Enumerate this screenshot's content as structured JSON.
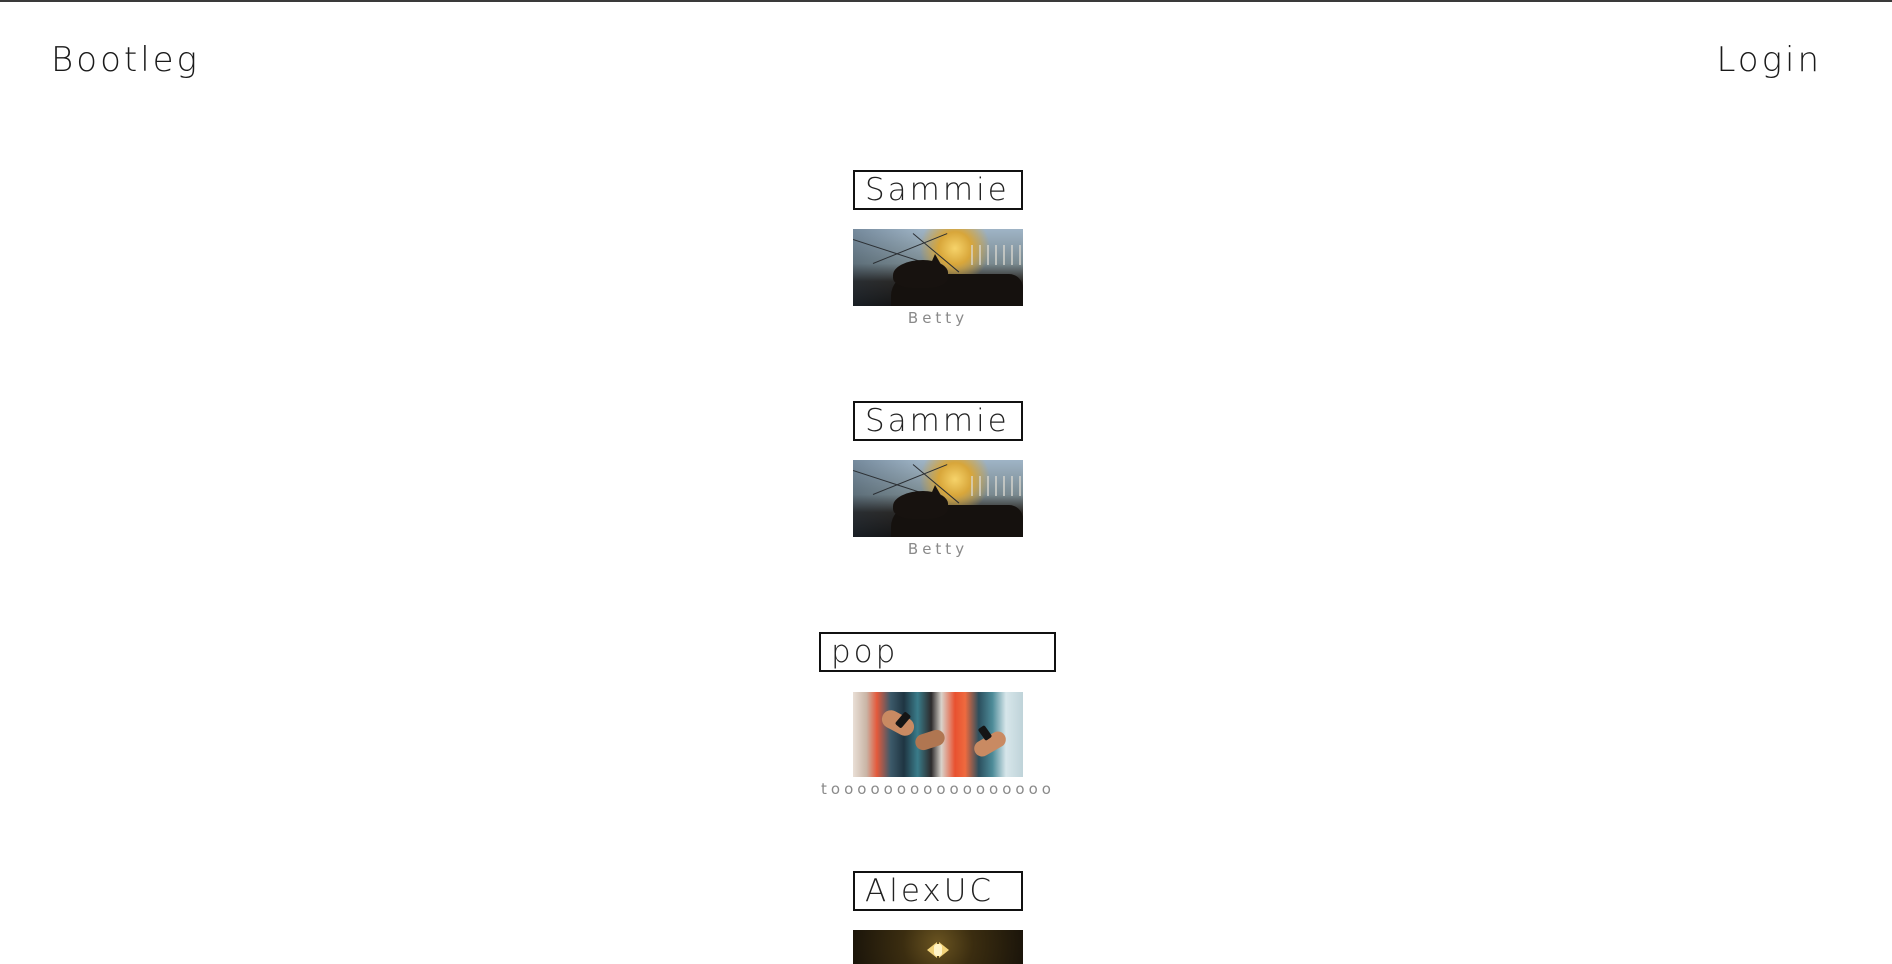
{
  "header": {
    "brand": "Bootleg",
    "login_label": "Login"
  },
  "posts": [
    {
      "title": "Sammie",
      "caption": "Betty",
      "image": "dog-silhouette-sunset-photo"
    },
    {
      "title": "Sammie",
      "caption": "Betty",
      "image": "dog-silhouette-sunset-photo"
    },
    {
      "title": "pop",
      "caption": "tooooooooooooooooo",
      "image": "people-holding-phones-photo"
    },
    {
      "title": "AlexUC",
      "caption": "",
      "image": "gold-emblem-photo"
    }
  ],
  "colors": {
    "text": "#1a1a1a",
    "caption": "#8a8a8a",
    "border": "#111111",
    "top_rule": "#3a3a3a"
  }
}
